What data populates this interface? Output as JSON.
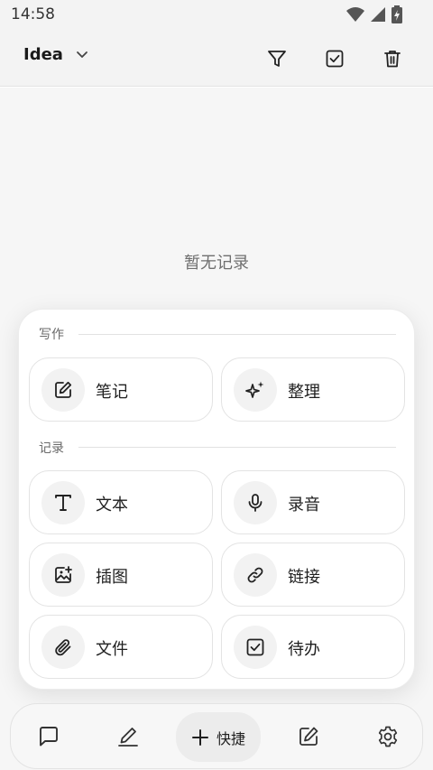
{
  "status_bar": {
    "time": "14:58",
    "icons": [
      "wifi-icon",
      "signal-icon",
      "battery-icon"
    ]
  },
  "header": {
    "title": "Idea",
    "actions": [
      "filter-icon",
      "checkbox-icon",
      "trash-icon"
    ]
  },
  "content": {
    "empty_text": "暂无记录"
  },
  "quick_panel": {
    "writing": {
      "label": "写作",
      "items": [
        {
          "label": "笔记",
          "icon": "edit-note-icon"
        },
        {
          "label": "整理",
          "icon": "sparkle-icon"
        }
      ]
    },
    "record": {
      "label": "记录",
      "items": [
        {
          "label": "文本",
          "icon": "text-icon"
        },
        {
          "label": "录音",
          "icon": "microphone-icon"
        },
        {
          "label": "插图",
          "icon": "image-add-icon"
        },
        {
          "label": "链接",
          "icon": "link-icon"
        },
        {
          "label": "文件",
          "icon": "paperclip-icon"
        },
        {
          "label": "待办",
          "icon": "todo-checkbox-icon"
        }
      ]
    }
  },
  "bottom_nav": {
    "items": [
      "chat-icon",
      "pen-icon",
      "quick",
      "edit-icon",
      "settings-icon"
    ],
    "quick_label": "快捷"
  }
}
